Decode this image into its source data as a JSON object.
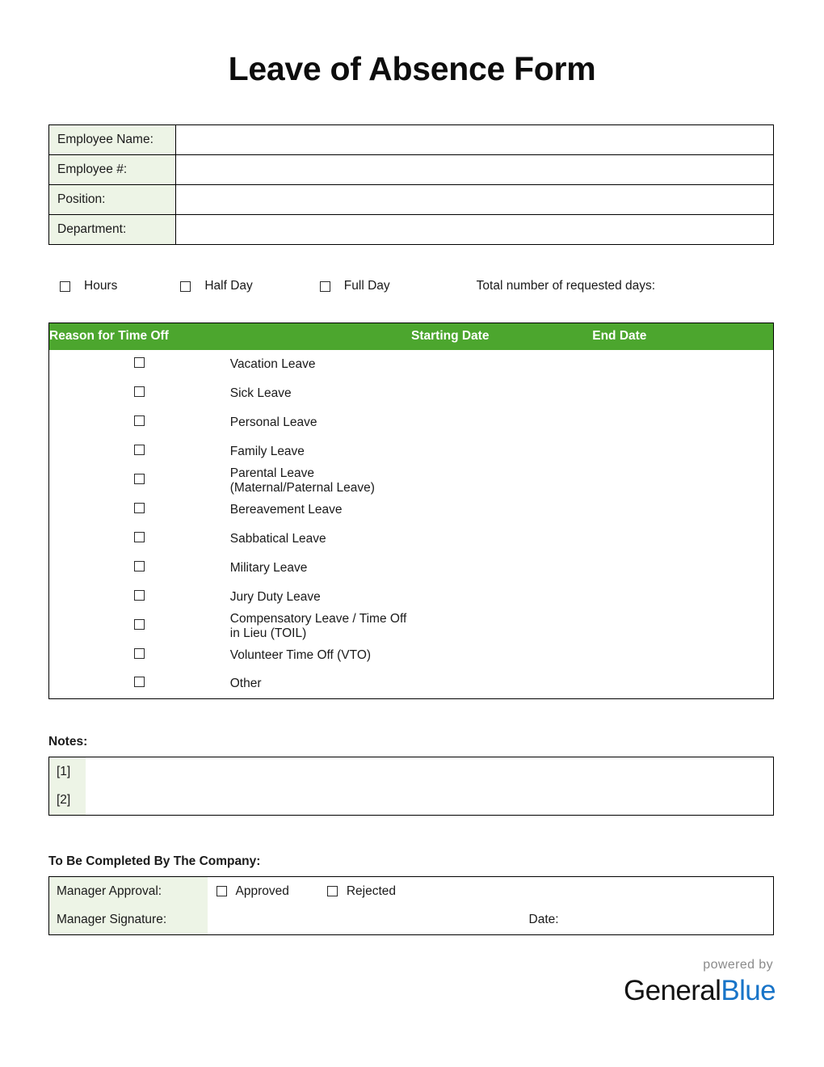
{
  "title": "Leave of Absence Form",
  "employee_info": {
    "rows": [
      {
        "label": "Employee Name:",
        "value": ""
      },
      {
        "label": "Employee #:",
        "value": ""
      },
      {
        "label": "Position:",
        "value": ""
      },
      {
        "label": "Department:",
        "value": ""
      }
    ]
  },
  "duration": {
    "options": [
      {
        "label": "Hours",
        "checked": false
      },
      {
        "label": "Half Day",
        "checked": false
      },
      {
        "label": "Full Day",
        "checked": false
      }
    ],
    "total_days_label": "Total number of requested days:",
    "total_days_value": ""
  },
  "reason_table": {
    "headers": {
      "reason": "Reason for Time Off",
      "starting_date": "Starting Date",
      "end_date": "End Date"
    },
    "rows": [
      {
        "label": "Vacation Leave",
        "checked": false,
        "start": "",
        "end": ""
      },
      {
        "label": "Sick Leave",
        "checked": false,
        "start": "",
        "end": ""
      },
      {
        "label": "Personal Leave",
        "checked": false,
        "start": "",
        "end": ""
      },
      {
        "label": "Family Leave",
        "checked": false,
        "start": "",
        "end": ""
      },
      {
        "label": "Parental Leave (Maternal/Paternal Leave)",
        "checked": false,
        "start": "",
        "end": ""
      },
      {
        "label": "Bereavement Leave",
        "checked": false,
        "start": "",
        "end": ""
      },
      {
        "label": "Sabbatical Leave",
        "checked": false,
        "start": "",
        "end": ""
      },
      {
        "label": "Military Leave",
        "checked": false,
        "start": "",
        "end": ""
      },
      {
        "label": "Jury Duty Leave",
        "checked": false,
        "start": "",
        "end": ""
      },
      {
        "label": "Compensatory Leave / Time Off in Lieu (TOIL)",
        "checked": false,
        "start": "",
        "end": ""
      },
      {
        "label": "Volunteer Time Off (VTO)",
        "checked": false,
        "start": "",
        "end": ""
      },
      {
        "label": "Other",
        "checked": false,
        "start": "",
        "end": ""
      }
    ]
  },
  "notes": {
    "label": "Notes:",
    "rows": [
      {
        "marker": "[1]",
        "value": ""
      },
      {
        "marker": "[2]",
        "value": ""
      }
    ]
  },
  "company": {
    "label": "To Be Completed By The Company:",
    "manager_approval_label": "Manager Approval:",
    "approved_label": "Approved",
    "approved_checked": false,
    "rejected_label": "Rejected",
    "rejected_checked": false,
    "manager_signature_label": "Manager Signature:",
    "signature_value": "",
    "date_label": "Date:",
    "date_value": ""
  },
  "footer": {
    "powered_by": "powered by",
    "brand_first": "General",
    "brand_second": "Blue"
  },
  "colors": {
    "header_green": "#4ca62e",
    "cell_green": "#edf4e6",
    "brand_blue": "#1874c8",
    "border": "#000000"
  }
}
